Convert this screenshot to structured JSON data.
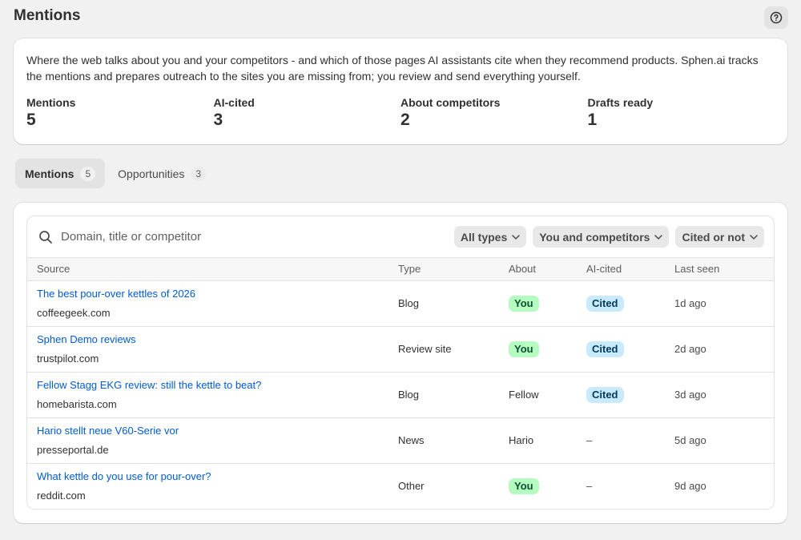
{
  "page": {
    "title": "Mentions"
  },
  "summary": {
    "description": "Where the web talks about you and your competitors - and which of those pages AI assistants cite when they recommend products. Sphen.ai tracks the mentions and prepares outreach to the sites you are missing from; you review and send everything yourself.",
    "stats": [
      {
        "label": "Mentions",
        "value": "5"
      },
      {
        "label": "AI-cited",
        "value": "3"
      },
      {
        "label": "About competitors",
        "value": "2"
      },
      {
        "label": "Drafts ready",
        "value": "1"
      }
    ]
  },
  "tabs": [
    {
      "label": "Mentions",
      "count": "5",
      "active": true
    },
    {
      "label": "Opportunities",
      "count": "3",
      "active": false
    }
  ],
  "filters": {
    "search_placeholder": "Domain, title or competitor",
    "type": "All types",
    "about": "You and competitors",
    "cited": "Cited or not"
  },
  "table": {
    "headers": {
      "source": "Source",
      "type": "Type",
      "about": "About",
      "ai_cited": "AI-cited",
      "last_seen": "Last seen"
    },
    "rows": [
      {
        "title": "The best pour-over kettles of 2026",
        "domain": "coffeegeek.com",
        "type": "Blog",
        "about": "You",
        "about_is_you": true,
        "ai_cited": "Cited",
        "last_seen": "1d ago"
      },
      {
        "title": "Sphen Demo reviews",
        "domain": "trustpilot.com",
        "type": "Review site",
        "about": "You",
        "about_is_you": true,
        "ai_cited": "Cited",
        "last_seen": "2d ago"
      },
      {
        "title": "Fellow Stagg EKG review: still the kettle to beat?",
        "domain": "homebarista.com",
        "type": "Blog",
        "about": "Fellow",
        "about_is_you": false,
        "ai_cited": "Cited",
        "last_seen": "3d ago"
      },
      {
        "title": "Hario stellt neue V60-Serie vor",
        "domain": "presseportal.de",
        "type": "News",
        "about": "Hario",
        "about_is_you": false,
        "ai_cited": "–",
        "last_seen": "5d ago"
      },
      {
        "title": "What kettle do you use for pour-over?",
        "domain": "reddit.com",
        "type": "Other",
        "about": "You",
        "about_is_you": true,
        "ai_cited": "–",
        "last_seen": "9d ago"
      }
    ]
  },
  "icons": {
    "help": "question-circle-icon",
    "search": "search-icon",
    "chevron": "chevron-down-icon"
  }
}
